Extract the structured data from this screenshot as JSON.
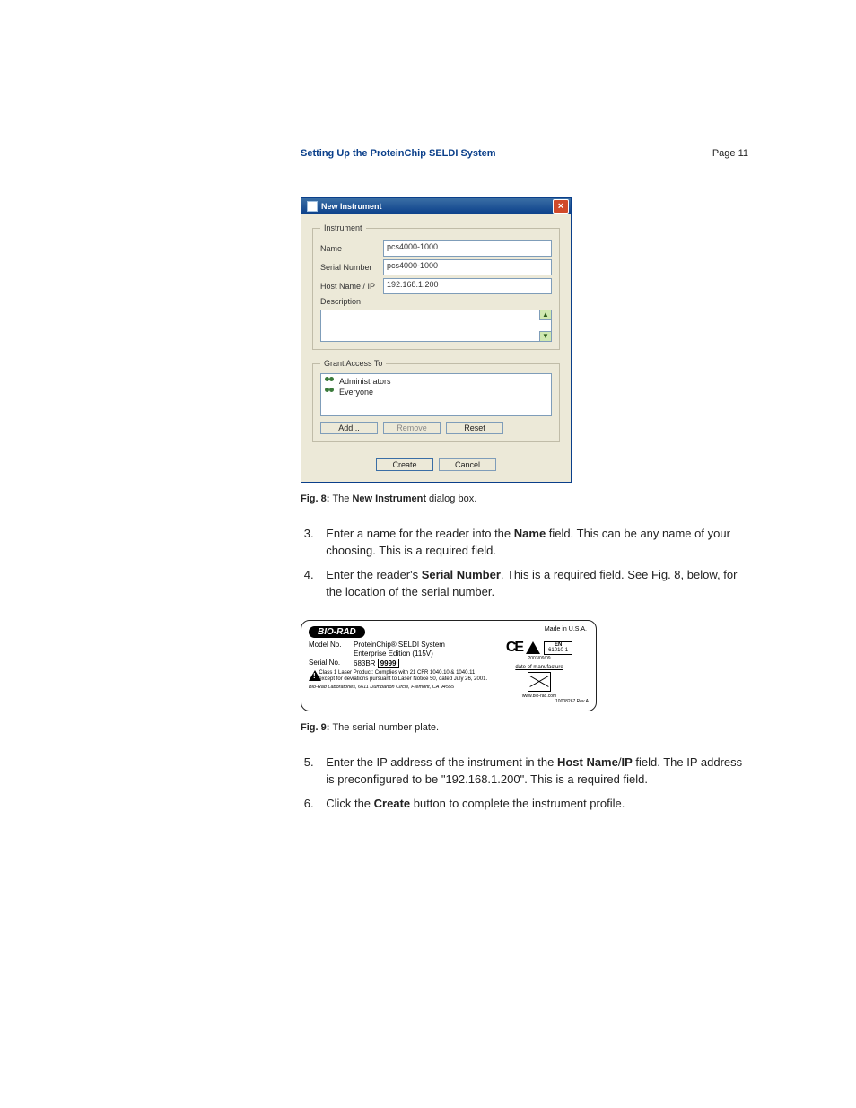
{
  "header": {
    "title": "Setting Up the ProteinChip SELDI System",
    "page_label": "Page 11"
  },
  "fig8": {
    "dialog_title": "New Instrument",
    "fields": {
      "instrument_legend": "Instrument",
      "name_label": "Name",
      "name_value": "pcs4000-1000",
      "serial_label": "Serial Number",
      "serial_value": "pcs4000-1000",
      "host_label": "Host Name / IP",
      "host_value": "192.168.1.200",
      "description_label": "Description"
    },
    "access": {
      "legend": "Grant Access To",
      "items": [
        "Administrators",
        "Everyone"
      ]
    },
    "buttons": {
      "add": "Add...",
      "remove": "Remove",
      "reset": "Reset",
      "create": "Create",
      "cancel": "Cancel"
    },
    "caption_prefix": "Fig. 8: ",
    "caption_body_pre": "The ",
    "caption_bold": "New Instrument",
    "caption_body_post": " dialog box."
  },
  "steps_a": {
    "s3_pre": "Enter a name for the reader into the ",
    "s3_b": "Name",
    "s3_post": " field. This can be any name of your choosing. This is a required field.",
    "s4_pre": "Enter the reader's ",
    "s4_b": "Serial Number",
    "s4_post": ". This is a required field. See Fig. 8, below, for the location of the serial number."
  },
  "fig9": {
    "logo": "BIO-RAD",
    "made_in": "Made in U.S.A.",
    "model_k": "Model No.",
    "model_v1": "ProteinChip® SELDI System",
    "model_v2": "Enterprise Edition (115V)",
    "serial_k": "Serial No.",
    "serial_prefix": "683BR",
    "serial_boxed": "9999",
    "compliance": "Class 1 Laser Product: Complies with 21 CFR 1040.10 & 1040.11 except for deviations pursuant to Laser Notice 50, dated July 26, 2001.",
    "cert_en_top": "EN",
    "cert_en_bot": "61010-1",
    "date_lbl": "date of manufacture",
    "date_code": "2003/09/09",
    "url": "www.bio-rad.com",
    "rev": "10008267 Rev A",
    "address": "Bio-Rad Laboratories, 6611 Dumbarton Circle, Fremont, CA 94555",
    "caption": "Fig. 9: ",
    "caption_body": "The serial number plate."
  },
  "steps_b": {
    "s5_pre": "Enter the IP address of the instrument in the ",
    "s5_b1": "Host Name",
    "s5_mid": "/",
    "s5_b2": "IP",
    "s5_post": " field. The IP address is preconfigured to be \"192.168.1.200\". This is a required field.",
    "s6_pre": "Click the ",
    "s6_b": "Create",
    "s6_post": " button to complete the instrument profile."
  }
}
